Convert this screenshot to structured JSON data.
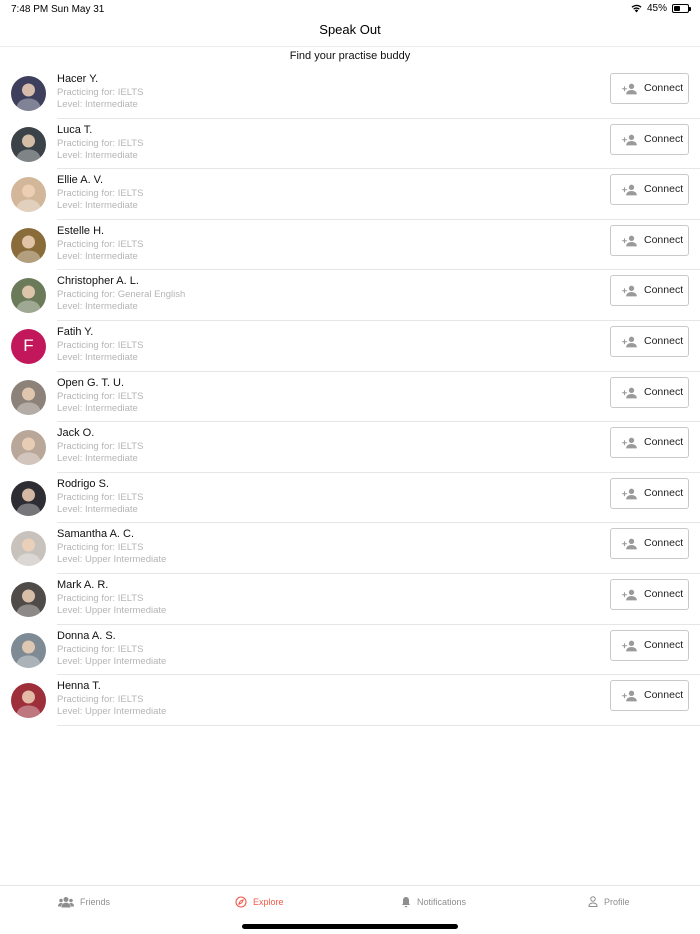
{
  "status_bar": {
    "time": "7:48 PM",
    "date": "Sun May 31",
    "battery_text": "45%",
    "battery_level": 0.45,
    "icons": [
      "wifi-icon",
      "battery-icon"
    ]
  },
  "header": {
    "title": "Speak Out",
    "subtitle": "Find your practise buddy"
  },
  "connect_label": "Connect",
  "users": [
    {
      "name": "Hacer Y.",
      "practicing": "Practicing for: IELTS",
      "level": "Level: Intermediate",
      "avatar_color": "#3d3f5c"
    },
    {
      "name": "Luca T.",
      "practicing": "Practicing for: IELTS",
      "level": "Level: Intermediate",
      "avatar_color": "#3b4248"
    },
    {
      "name": "Ellie A. V.",
      "practicing": "Practicing for: IELTS",
      "level": "Level: Intermediate",
      "avatar_color": "#d2b79a"
    },
    {
      "name": "Estelle H.",
      "practicing": "Practicing for: IELTS",
      "level": "Level: Intermediate",
      "avatar_color": "#8a6c3a"
    },
    {
      "name": "Christopher A. L.",
      "practicing": "Practicing for: General English",
      "level": "Level: Intermediate",
      "avatar_color": "#6b7a58"
    },
    {
      "name": "Fatih Y.",
      "practicing": "Practicing for: IELTS",
      "level": "Level: Intermediate",
      "avatar_color": "#c2185b",
      "letter": "F"
    },
    {
      "name": "Open G. T. U.",
      "practicing": "Practicing for: IELTS",
      "level": "Level: Intermediate",
      "avatar_color": "#8d8279"
    },
    {
      "name": "Jack O.",
      "practicing": "Practicing for: IELTS",
      "level": "Level: Intermediate",
      "avatar_color": "#b9a79a"
    },
    {
      "name": "Rodrigo S.",
      "practicing": "Practicing for: IELTS",
      "level": "Level: Intermediate",
      "avatar_color": "#2e2d33"
    },
    {
      "name": "Samantha A. C.",
      "practicing": "Practicing for: IELTS",
      "level": "Level: Upper Intermediate",
      "avatar_color": "#c8c2bd"
    },
    {
      "name": "Mark A. R.",
      "practicing": "Practicing for: IELTS",
      "level": "Level: Upper Intermediate",
      "avatar_color": "#4f4b48"
    },
    {
      "name": "Donna A. S.",
      "practicing": "Practicing for: IELTS",
      "level": "Level: Upper Intermediate",
      "avatar_color": "#7e8a94"
    },
    {
      "name": "Henna T.",
      "practicing": "Practicing for: IELTS",
      "level": "Level: Upper Intermediate",
      "avatar_color": "#9c2f3a"
    }
  ],
  "tabs": [
    {
      "label": "Friends",
      "icon": "friends-icon",
      "active": false
    },
    {
      "label": "Explore",
      "icon": "compass-icon",
      "active": true
    },
    {
      "label": "Notifications",
      "icon": "bell-icon",
      "active": false
    },
    {
      "label": "Profile",
      "icon": "person-icon",
      "active": false
    }
  ],
  "colors": {
    "accent": "#f15a4a",
    "secondary_text": "#b5b5b5",
    "inactive_tab": "#8e8e8e"
  }
}
